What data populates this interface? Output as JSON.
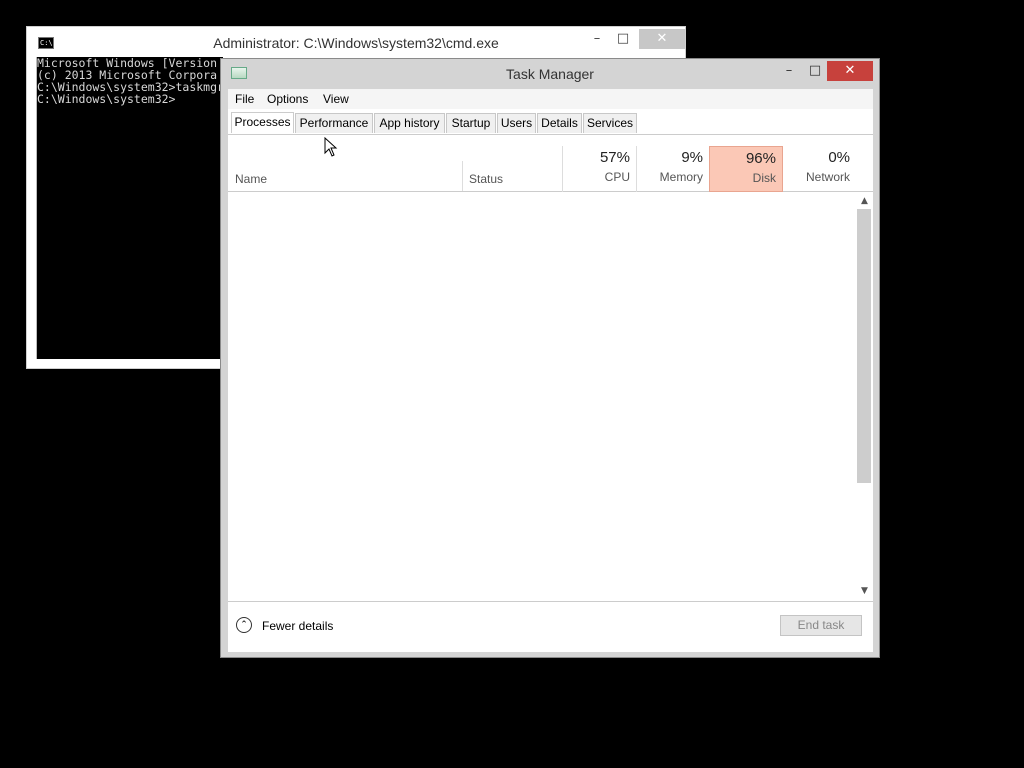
{
  "cmd": {
    "title": "Administrator: C:\\Windows\\system32\\cmd.exe",
    "icon_text": "C:\\",
    "lines": [
      "Microsoft Windows [Version",
      "(c) 2013 Microsoft Corpora",
      "",
      "C:\\Windows\\system32>taskmgr",
      "",
      "C:\\Windows\\system32>"
    ],
    "controls": {
      "minimize": "–",
      "maximize": "□",
      "close": "✕"
    }
  },
  "task_manager": {
    "title": "Task Manager",
    "controls": {
      "minimize": "–",
      "maximize": "□",
      "close": "✕"
    },
    "menu": [
      "File",
      "Options",
      "View"
    ],
    "tabs": [
      "Processes",
      "Performance",
      "App history",
      "Startup",
      "Users",
      "Details",
      "Services"
    ],
    "active_tab": "Processes",
    "columns": {
      "name": "Name",
      "status": "Status",
      "cpu": {
        "value": "57%",
        "label": "CPU"
      },
      "memory": {
        "value": "9%",
        "label": "Memory"
      },
      "disk": {
        "value": "96%",
        "label": "Disk"
      },
      "network": {
        "value": "0%",
        "label": "Network"
      }
    },
    "footer": {
      "fewer_details": "Fewer details",
      "end_task": "End task"
    },
    "colors": {
      "disk_highlight": "#fbc8b6",
      "close_button": "#c7413c"
    }
  }
}
